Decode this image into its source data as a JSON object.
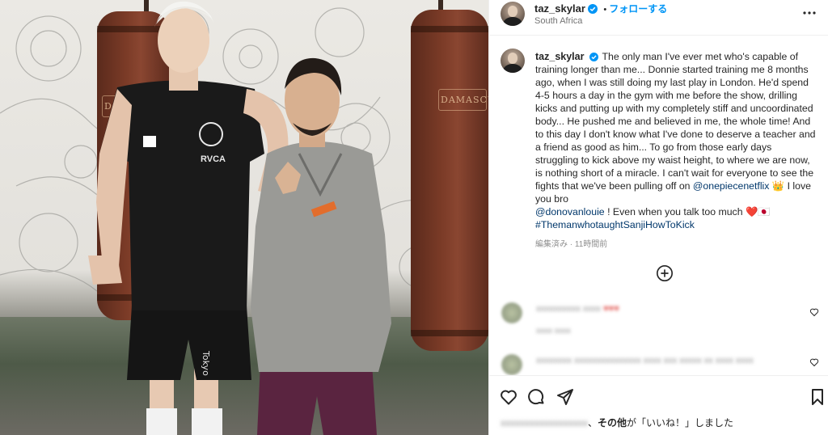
{
  "post": {
    "username": "taz_skylar",
    "follow_label": "フォローする",
    "separator": "•",
    "location": "South Africa",
    "caption_text": "The only man I've ever met who's capable of training longer than me... Donnie started training me 8 months ago, when I was still doing my last play in London. He'd spend 4-5 hours a day in the gym with me before the show, drilling kicks and putting up with my completely stiff and uncoordinated body... He pushed me and believed in me, the whole time! And to this day I don't know what I've done to deserve a teacher and a friend as good as him... To go from those early days struggling to kick above my waist height, to where we are now, is nothing short of a miracle. I can't wait for everyone to see the fights that we've been pulling off on",
    "mention_1": "@onepiecenetflix",
    "emoji_crown": "👑",
    "text_after_mention_1": " I love you bro",
    "mention_2": "@donovanlouie",
    "text_after_mention_2": " ! Even when you talk too much ",
    "emoji_tail": "❤️🇯🇵",
    "hashtag": "#ThemanwhotaughtSanjiHowToKick",
    "edited_label": "編集済み · 11時間前",
    "likes_user_blurred": "xxxxxxxxxxxxxxxxxx",
    "likes_suffix": "、",
    "likes_bold": "その他",
    "likes_tail": "が「いいね！」しました"
  },
  "photo": {
    "bag_brand": "DAMASCUS",
    "shorts_text": "京 Tokyo",
    "shirt_text": "RVCA"
  },
  "comments": [
    {
      "user_blurred": "xxxxxxxxxx xxxx",
      "text_blurred": "♥♥♥",
      "meta_blurred": "xxxx xxxx"
    },
    {
      "user_blurred": "xxxxxxxx",
      "text_blurred": "xxxxxxxxxxxxxxx xxxx xxx xxxxx xx xxxx xxxx"
    }
  ],
  "colors": {
    "accent": "#0095f6",
    "link": "#00376b",
    "verified": "#0095f6"
  },
  "icons": [
    "verified-badge-icon",
    "more-options-icon",
    "add-comments-icon",
    "heart-icon",
    "comment-icon",
    "share-icon",
    "bookmark-icon"
  ]
}
